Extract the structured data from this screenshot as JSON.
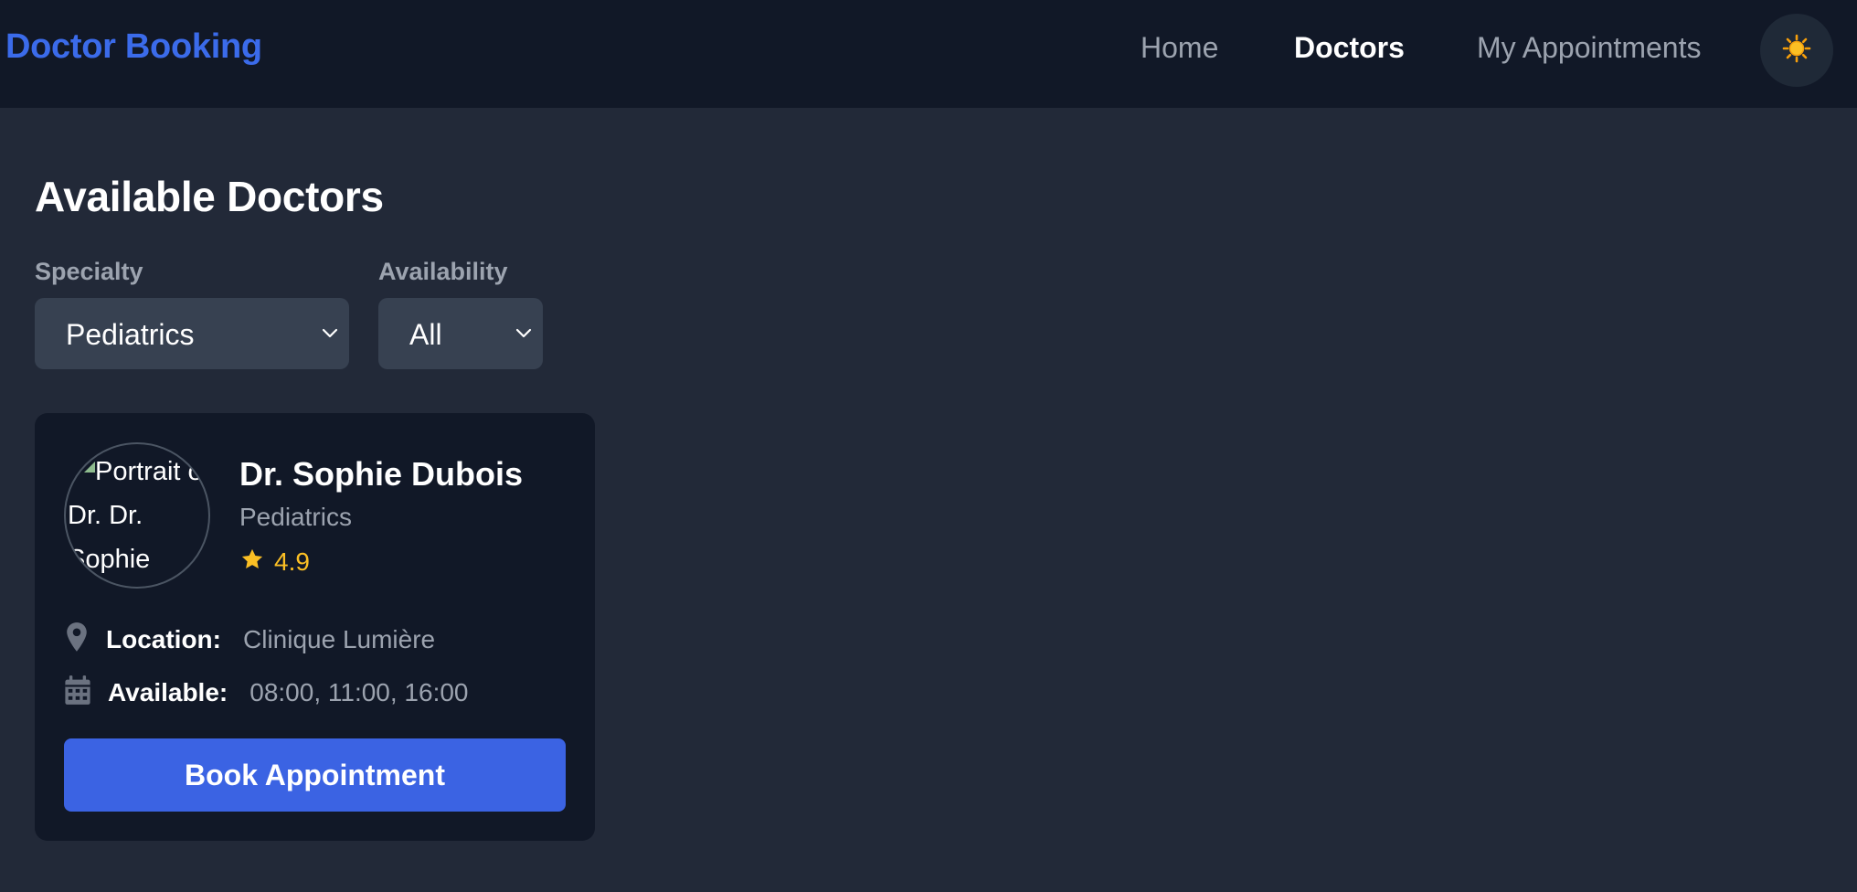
{
  "navbar": {
    "brand": "Doctor Booking",
    "links": [
      {
        "label": "Home",
        "active": false
      },
      {
        "label": "Doctors",
        "active": true
      },
      {
        "label": "My Appointments",
        "active": false
      }
    ],
    "theme_toggle_icon": "sun-icon"
  },
  "main": {
    "title": "Available Doctors",
    "filters": {
      "specialty": {
        "label": "Specialty",
        "value": "Pediatrics"
      },
      "availability": {
        "label": "Availability",
        "value": "All"
      }
    }
  },
  "doctors": [
    {
      "avatar_alt": "Portrait of Dr. Dr. Sophie",
      "name": "Dr. Sophie Dubois",
      "specialty": "Pediatrics",
      "rating": "4.9",
      "location_label": "Location:",
      "location": "Clinique Lumière",
      "available_label": "Available:",
      "available": "08:00, 11:00, 16:00",
      "book_label": "Book Appointment"
    }
  ],
  "colors": {
    "accent": "#3b63e3",
    "brand": "#3b6bea",
    "star": "#fbbf24",
    "page_bg": "#222938",
    "nav_bg": "#111827",
    "card_bg": "#111827"
  }
}
